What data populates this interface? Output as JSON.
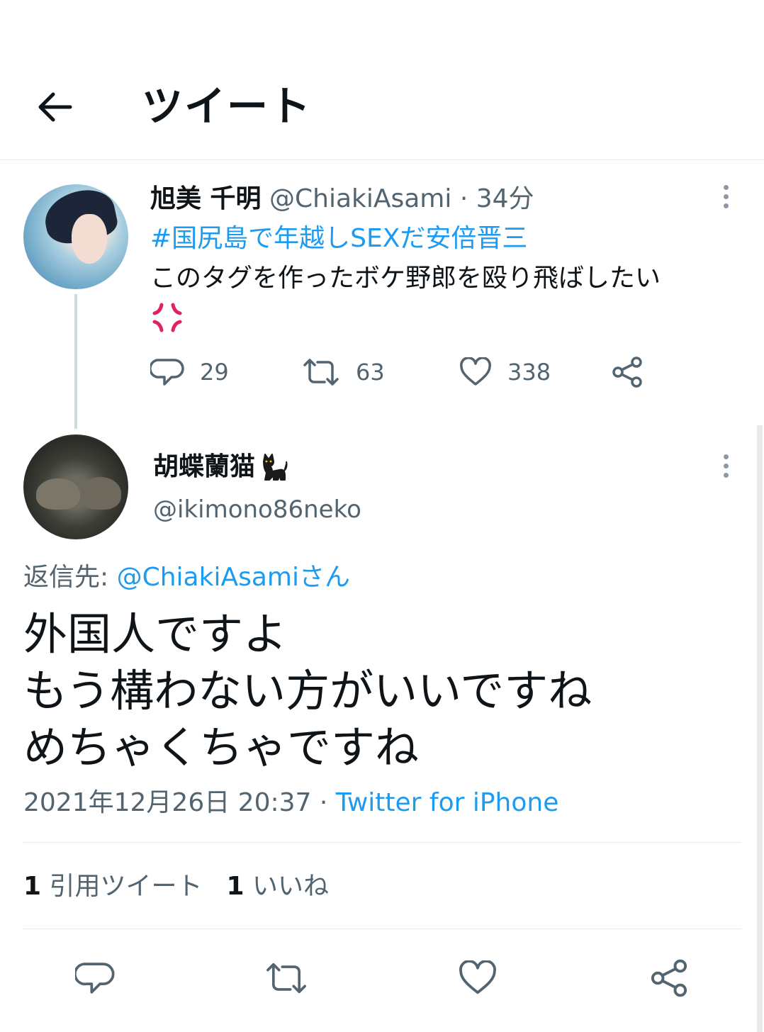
{
  "header": {
    "title": "ツイート"
  },
  "parent_tweet": {
    "name": "旭美 千明",
    "handle": "@ChiakiAsami",
    "separator": "·",
    "time": "34分",
    "hashtag": "#国尻島で年越しSEXだ安倍晋三",
    "text": "このタグを作ったボケ野郎を殴り飛ばしたい",
    "emoji": "anger-symbol",
    "replies": "29",
    "retweets": "63",
    "likes": "338"
  },
  "reply_tweet": {
    "name": "胡蝶蘭猫",
    "name_emoji": "black-cat",
    "handle": "@ikimono86neko",
    "reply_to_label": "返信先:",
    "reply_to_mention": "@ChiakiAsamiさん",
    "text_lines": [
      "外国人ですよ",
      "もう構わない方がいいですね",
      "めちゃくちゃですね"
    ],
    "date": "2021年12月26日 20:37",
    "separator": "·",
    "source": "Twitter for iPhone",
    "quote_count": "1",
    "quote_label": "引用ツイート",
    "like_count": "1",
    "like_label": "いいね"
  },
  "colors": {
    "accent": "#1d9bf0",
    "secondary_text": "#536471",
    "primary_text": "#0f1419"
  }
}
